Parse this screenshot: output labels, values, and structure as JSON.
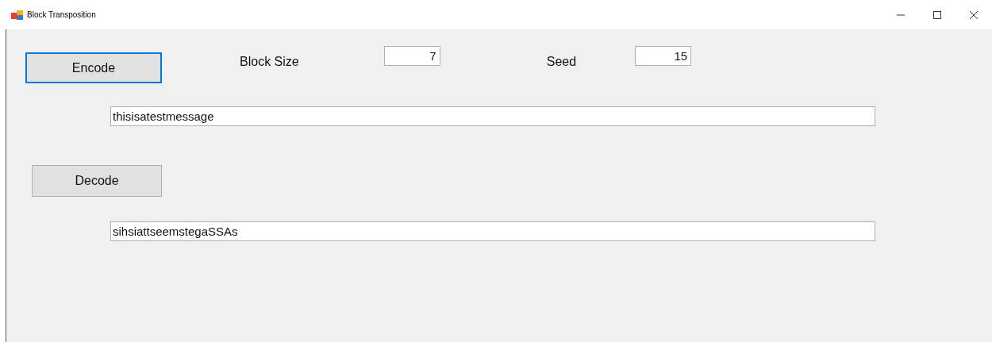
{
  "window": {
    "title": "Block Transposition"
  },
  "encode_button": {
    "label": "Encode",
    "focused": true
  },
  "block_size": {
    "label": "Block Size",
    "value": "7"
  },
  "seed": {
    "label": "Seed",
    "value": "15"
  },
  "plain_text": {
    "value": "thisisatestmessage"
  },
  "decode_button": {
    "label": "Decode",
    "focused": false
  },
  "cipher_text": {
    "value": "sihsiattseemstegaSSAs"
  }
}
